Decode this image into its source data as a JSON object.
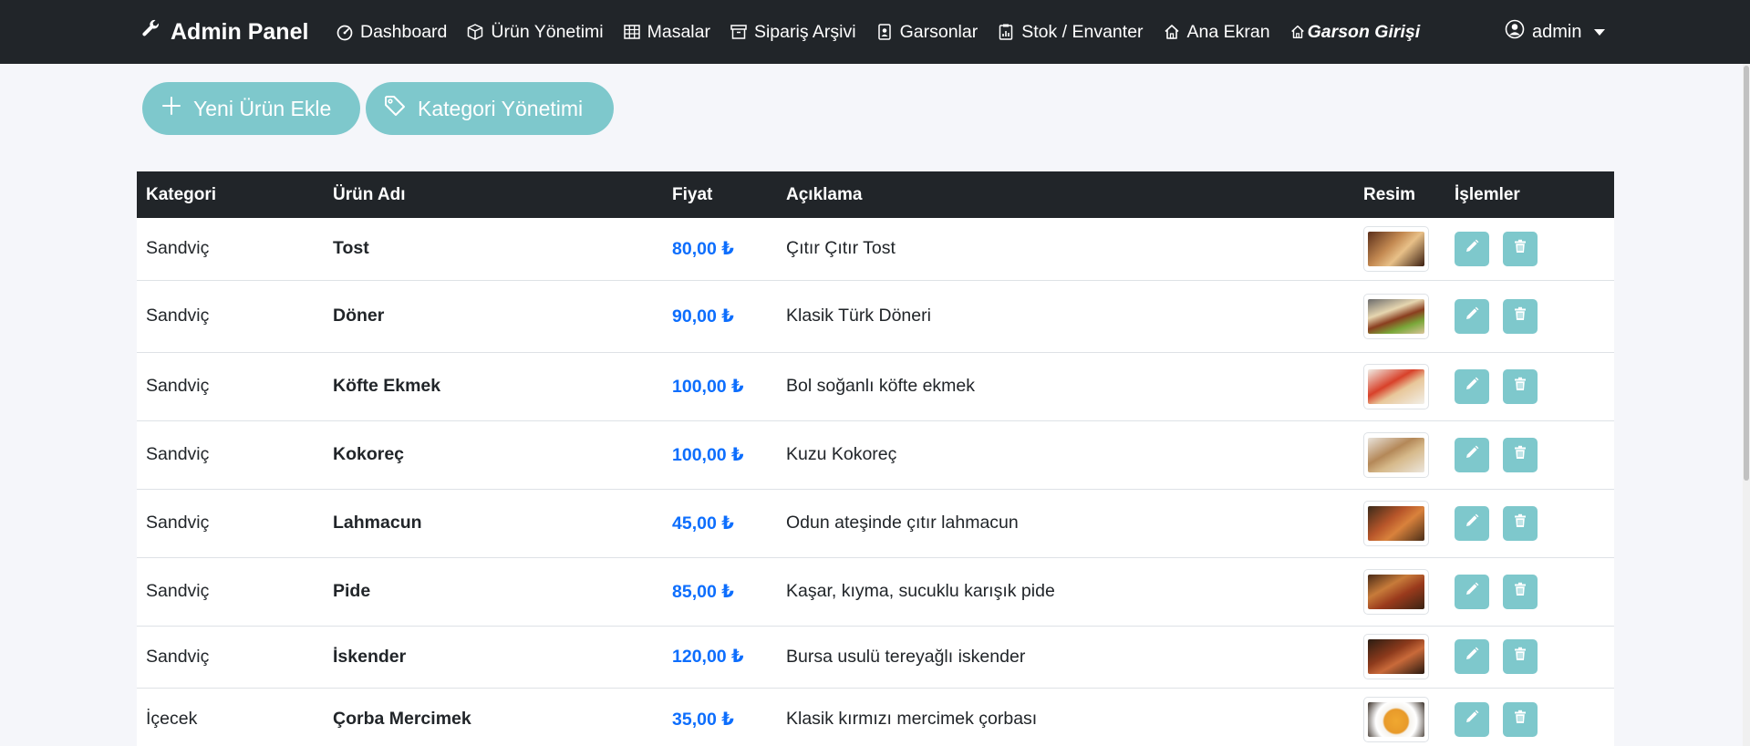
{
  "navbar": {
    "brand": "Admin Panel",
    "items": [
      {
        "label": "Dashboard",
        "icon": "gauge-icon"
      },
      {
        "label": "Ürün Yönetimi",
        "icon": "box-icon"
      },
      {
        "label": "Masalar",
        "icon": "table-grid-icon"
      },
      {
        "label": "Sipariş Arşivi",
        "icon": "archive-icon"
      },
      {
        "label": "Garsonlar",
        "icon": "badge-icon"
      },
      {
        "label": "Stok / Envanter",
        "icon": "clipboard-chart-icon"
      },
      {
        "label": "Ana Ekran",
        "icon": "house-icon"
      },
      {
        "label": "Garson Girişi",
        "icon": "house-icon"
      }
    ],
    "user": "admin"
  },
  "actions": {
    "add_product": "Yeni Ürün Ekle",
    "category_management": "Kategori Yönetimi"
  },
  "table": {
    "headers": [
      "Kategori",
      "Ürün Adı",
      "Fiyat",
      "Açıklama",
      "Resim",
      "İşlemler"
    ],
    "rows": [
      {
        "category": "Sandviç",
        "name": "Tost",
        "price": "80,00 ₺",
        "description": "Çıtır Çıtır Tost"
      },
      {
        "category": "Sandviç",
        "name": "Döner",
        "price": "90,00 ₺",
        "description": "Klasik Türk Döneri"
      },
      {
        "category": "Sandviç",
        "name": "Köfte Ekmek",
        "price": "100,00 ₺",
        "description": "Bol soğanlı köfte ekmek"
      },
      {
        "category": "Sandviç",
        "name": "Kokoreç",
        "price": "100,00 ₺",
        "description": "Kuzu Kokoreç"
      },
      {
        "category": "Sandviç",
        "name": "Lahmacun",
        "price": "45,00 ₺",
        "description": "Odun ateşinde çıtır lahmacun"
      },
      {
        "category": "Sandviç",
        "name": "Pide",
        "price": "85,00 ₺",
        "description": "Kaşar, kıyma, sucuklu karışık pide"
      },
      {
        "category": "Sandviç",
        "name": "İskender",
        "price": "120,00 ₺",
        "description": "Bursa usulü tereyağlı iskender"
      },
      {
        "category": "İçecek",
        "name": "Çorba Mercimek",
        "price": "35,00 ₺",
        "description": "Klasik kırmızı mercimek çorbası"
      }
    ]
  },
  "colors": {
    "navbar": "#212529",
    "accent_button": "#7ec8cc",
    "price": "#0d6efd",
    "background": "#f5f6fa"
  }
}
